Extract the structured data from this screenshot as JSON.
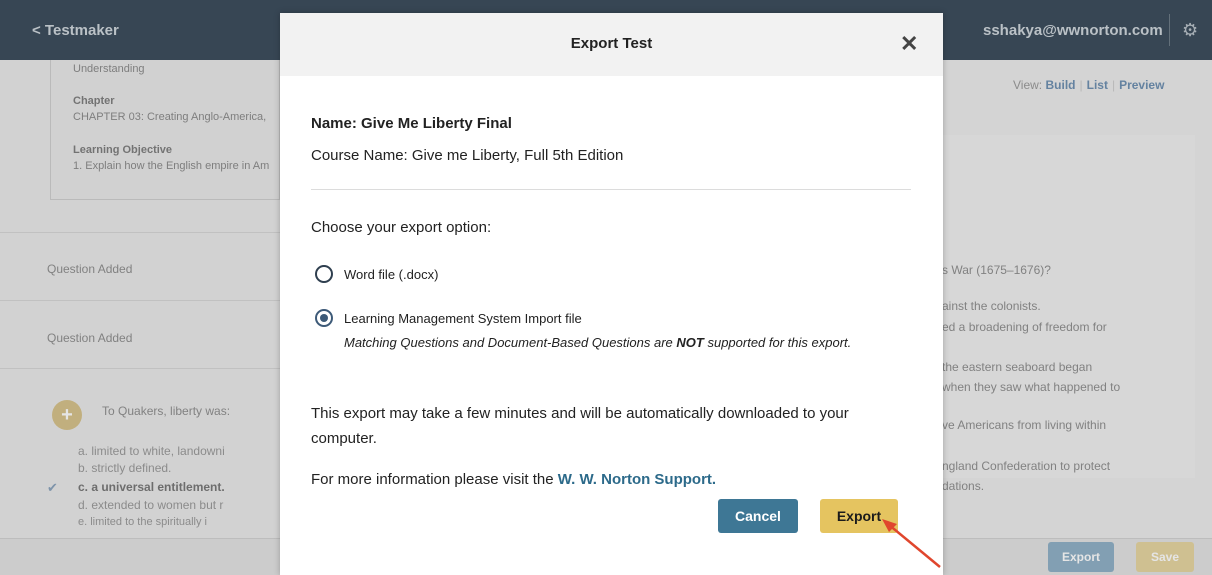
{
  "app": {
    "back_label": "< Testmaker",
    "user_email": "sshakya@wwnorton.com",
    "settings_icon": "gear-icon"
  },
  "left_panel": {
    "understanding": "Understanding",
    "chapter_label": "Chapter",
    "chapter_value": "CHAPTER 03: Creating Anglo-America,",
    "objective_label": "Learning Objective",
    "objective_value": "1. Explain how the English empire in Am",
    "question_added_1": "Question Added",
    "question_added_2": "Question Added",
    "question_prompt": "To Quakers, liberty was:",
    "answers": [
      "a.  limited to white, landowni",
      "b.  strictly defined.",
      "c.  a universal entitlement.",
      "d.  extended to women but r",
      "e.  limited to the spiritually i"
    ]
  },
  "right_panel": {
    "view_label": "View:",
    "view_build": "Build",
    "view_list": "List",
    "view_preview": "Preview",
    "lines": [
      "s War (1675–1676)?",
      "ainst the colonists.",
      "ed a broadening of freedom for",
      "",
      "the eastern seaboard began",
      "when they saw what happened to",
      "ve Americans from living within",
      "ngland Confederation to protect",
      "dations."
    ],
    "export_label": "Export",
    "save_label": "Save"
  },
  "modal": {
    "title": "Export Test",
    "name": "Name: Give Me Liberty Final",
    "course": "Course Name: Give me Liberty, Full 5th Edition",
    "choose": "Choose your export option:",
    "option_word": "Word file (.docx)",
    "option_lms": "Learning Management System Import file",
    "lms_note_before": "Matching Questions and Document-Based Questions are ",
    "lms_note_bold": "NOT",
    "lms_note_after": " supported for this export.",
    "info": "This export may take a few minutes and will be automatically downloaded to your computer.",
    "more_prefix": "For more information please visit the ",
    "more_link": "W. W. Norton Support.",
    "cancel_label": "Cancel",
    "export_label": "Export",
    "selected_option": "lms"
  },
  "colors": {
    "topbar": "#3a4b5a",
    "cancel": "#3e7795",
    "export": "#e5c460",
    "link": "#2c6a8a",
    "arrow": "#e0462d"
  }
}
